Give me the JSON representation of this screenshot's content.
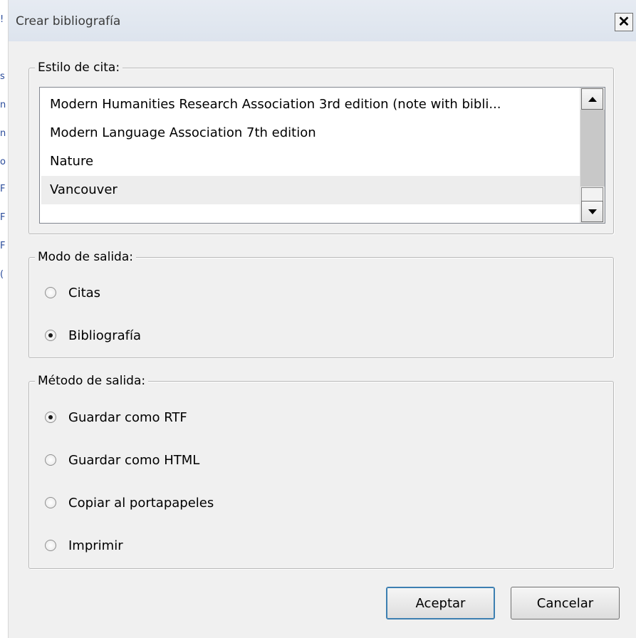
{
  "dialog": {
    "title": "Crear bibliografía",
    "close_symbol": "✕"
  },
  "citation_style": {
    "label": "Estilo de cita:",
    "items": [
      "Modern Humanities Research Association 3rd edition (note with bibli...",
      "Modern Language Association 7th edition",
      "Nature",
      "Vancouver"
    ],
    "selected": "Vancouver"
  },
  "output_mode": {
    "label": "Modo de salida:",
    "options": [
      {
        "label": "Citas",
        "checked": false
      },
      {
        "label": "Bibliografía",
        "checked": true
      }
    ]
  },
  "output_method": {
    "label": "Método de salida:",
    "options": [
      {
        "label": "Guardar como RTF",
        "checked": true
      },
      {
        "label": "Guardar como HTML",
        "checked": false
      },
      {
        "label": "Copiar al portapapeles",
        "checked": false
      },
      {
        "label": "Imprimir",
        "checked": false
      }
    ]
  },
  "buttons": {
    "accept": "Aceptar",
    "cancel": "Cancelar"
  },
  "background_window": {
    "fragments": [
      "!",
      "s",
      "n",
      "n",
      "o",
      "F",
      "F",
      "F",
      "("
    ]
  },
  "icons": {
    "close": "close-icon",
    "scroll_up": "arrow-up-icon",
    "scroll_down": "arrow-down-icon"
  }
}
